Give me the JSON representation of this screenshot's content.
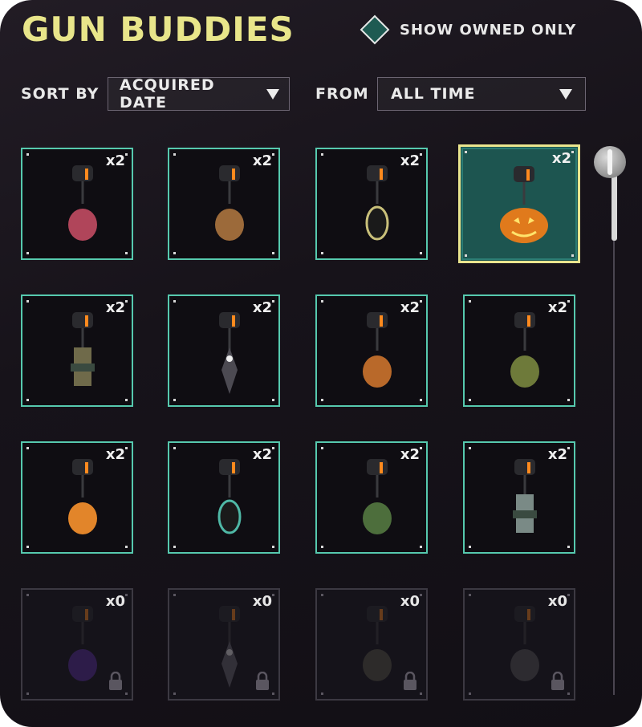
{
  "header": {
    "title": "GUN BUDDIES",
    "show_owned_label": "SHOW OWNED ONLY"
  },
  "filters": {
    "sort_label": "SORT BY",
    "sort_value": "ACQUIRED DATE",
    "from_label": "FROM",
    "from_value": "ALL TIME"
  },
  "colors": {
    "title": "#e8e58a",
    "owned_border": "#56c9ae",
    "selected_border": "#e9e58e",
    "selected_fill": "#1d5550"
  },
  "items": [
    {
      "count": "x2",
      "charm": "flower-charm",
      "state": "owned"
    },
    {
      "count": "x2",
      "charm": "potato-charm",
      "state": "owned"
    },
    {
      "count": "x2",
      "charm": "oval-tag-charm",
      "state": "owned"
    },
    {
      "count": "x2",
      "charm": "pumpkin-charm",
      "state": "selected"
    },
    {
      "count": "x2",
      "charm": "ruins-charm",
      "state": "owned"
    },
    {
      "count": "x2",
      "charm": "kunai-charm",
      "state": "owned"
    },
    {
      "count": "x2",
      "charm": "bear-charm",
      "state": "owned"
    },
    {
      "count": "x2",
      "charm": "bag-charm",
      "state": "owned"
    },
    {
      "count": "x2",
      "charm": "fox-charm",
      "state": "owned"
    },
    {
      "count": "x2",
      "charm": "teal-tag-charm",
      "state": "owned"
    },
    {
      "count": "x2",
      "charm": "green-creature-charm",
      "state": "owned"
    },
    {
      "count": "x2",
      "charm": "robot-charm",
      "state": "owned"
    },
    {
      "count": "x0",
      "charm": "purple-charm",
      "state": "locked"
    },
    {
      "count": "x0",
      "charm": "blade-charm",
      "state": "locked"
    },
    {
      "count": "x0",
      "charm": "round-charm",
      "state": "locked"
    },
    {
      "count": "x0",
      "charm": "claw-charm",
      "state": "locked"
    }
  ]
}
